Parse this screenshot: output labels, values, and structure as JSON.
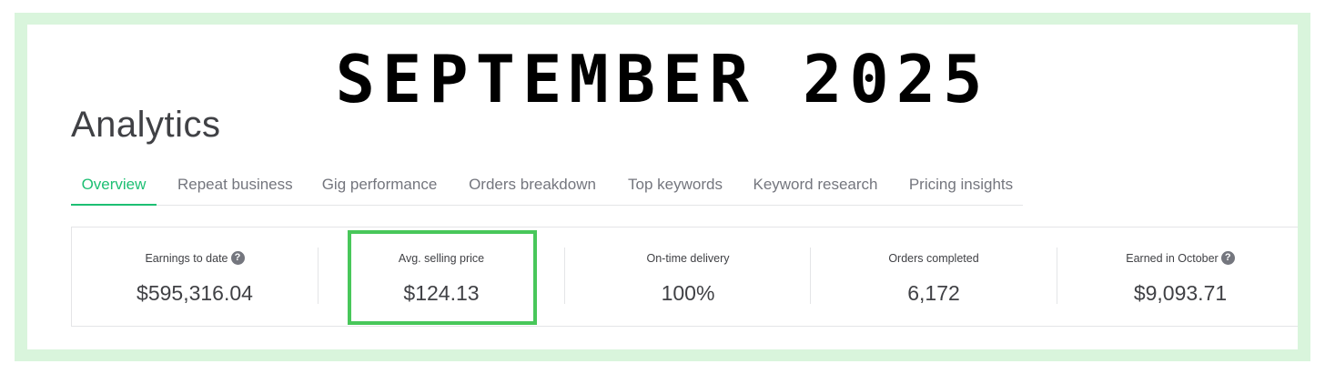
{
  "banner": {
    "text": "SEPTEMBER 2025"
  },
  "page": {
    "title": "Analytics"
  },
  "tabs": [
    {
      "label": "Overview",
      "active": true
    },
    {
      "label": "Repeat business",
      "active": false
    },
    {
      "label": "Gig performance",
      "active": false
    },
    {
      "label": "Orders breakdown",
      "active": false
    },
    {
      "label": "Top keywords",
      "active": false
    },
    {
      "label": "Keyword research",
      "active": false
    },
    {
      "label": "Pricing insights",
      "active": false
    }
  ],
  "stats": [
    {
      "label": "Earnings to date",
      "value": "$595,316.04",
      "has_help": true
    },
    {
      "label": "Avg. selling price",
      "value": "$124.13",
      "has_help": false,
      "highlighted": true
    },
    {
      "label": "On-time delivery",
      "value": "100%",
      "has_help": false
    },
    {
      "label": "Orders completed",
      "value": "6,172",
      "has_help": false
    },
    {
      "label": "Earned in October",
      "value": "$9,093.71",
      "has_help": true
    }
  ],
  "icons": {
    "help": "question-circle-icon",
    "help_glyph": "?"
  },
  "colors": {
    "accent_green": "#1dbf73",
    "highlight_green": "#48c75a",
    "frame_green": "#d9f5dc",
    "text_dark": "#404145",
    "text_muted": "#74767e"
  }
}
